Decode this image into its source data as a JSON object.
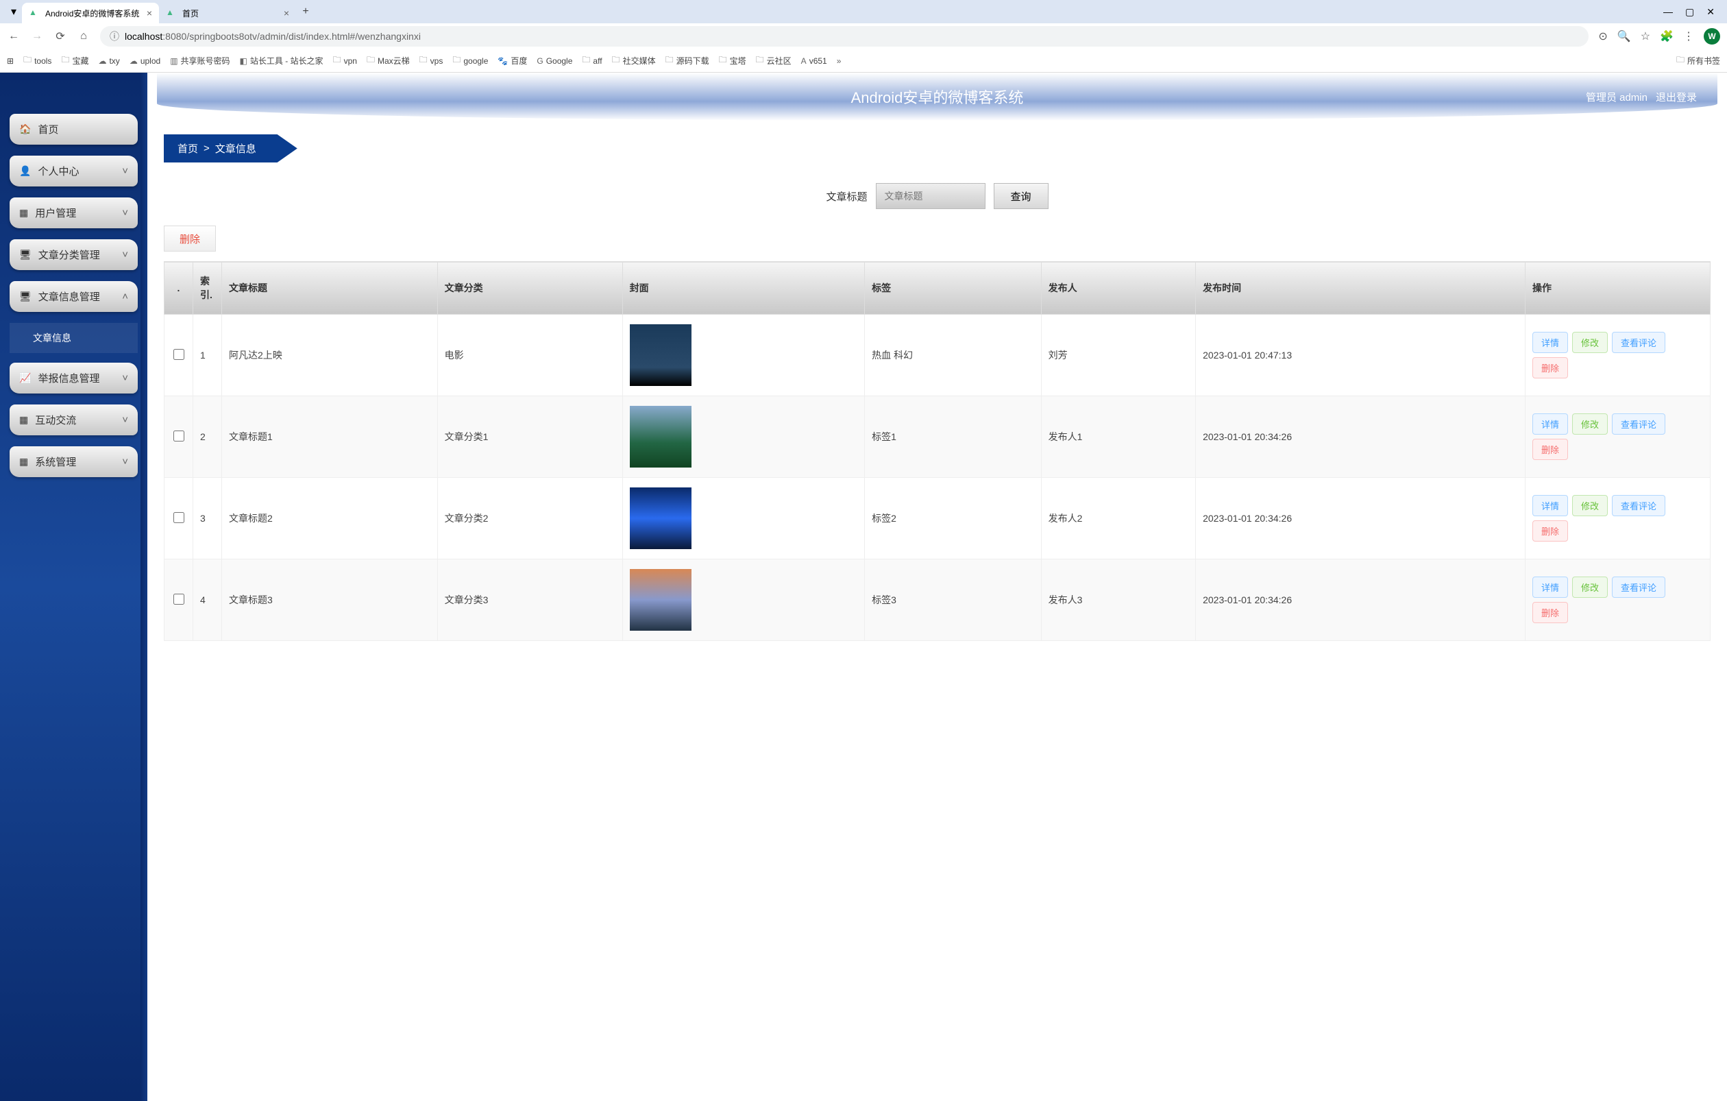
{
  "browser": {
    "tabs": [
      {
        "title": "Android安卓的微博客系统",
        "active": true
      },
      {
        "title": "首页",
        "active": false
      }
    ],
    "url_host": "localhost",
    "url_port": ":8080",
    "url_path": "/springboots8otv/admin/dist/index.html#/wenzhangxinxi",
    "avatar_letter": "W",
    "bookmarks": [
      {
        "label": "tools",
        "icon": "folder"
      },
      {
        "label": "宝藏",
        "icon": "folder"
      },
      {
        "label": "txy",
        "icon": "cloud"
      },
      {
        "label": "uplod",
        "icon": "cloud"
      },
      {
        "label": "共享账号密码",
        "icon": "sheet"
      },
      {
        "label": "站长工具 - 站长之家",
        "icon": "site"
      },
      {
        "label": "vpn",
        "icon": "folder"
      },
      {
        "label": "Max云梯",
        "icon": "folder"
      },
      {
        "label": "vps",
        "icon": "folder"
      },
      {
        "label": "google",
        "icon": "folder"
      },
      {
        "label": "百度",
        "icon": "baidu"
      },
      {
        "label": "Google",
        "icon": "g"
      },
      {
        "label": "aff",
        "icon": "folder"
      },
      {
        "label": "社交媒体",
        "icon": "folder"
      },
      {
        "label": "源码下载",
        "icon": "folder"
      },
      {
        "label": "宝塔",
        "icon": "folder"
      },
      {
        "label": "云社区",
        "icon": "folder"
      },
      {
        "label": "v651",
        "icon": "a"
      }
    ],
    "all_bookmarks": "所有书签"
  },
  "app": {
    "title": "Android安卓的微博客系统",
    "user_role": "管理员 admin",
    "logout": "退出登录"
  },
  "sidebar": {
    "items": [
      {
        "label": "首页",
        "icon": "🏠",
        "expandable": false
      },
      {
        "label": "个人中心",
        "icon": "👤",
        "expandable": true,
        "expanded": false
      },
      {
        "label": "用户管理",
        "icon": "▦",
        "expandable": true,
        "expanded": false
      },
      {
        "label": "文章分类管理",
        "icon": "🖥",
        "expandable": true,
        "expanded": false
      },
      {
        "label": "文章信息管理",
        "icon": "🖥",
        "expandable": true,
        "expanded": true
      },
      {
        "label": "举报信息管理",
        "icon": "📈",
        "expandable": true,
        "expanded": false
      },
      {
        "label": "互动交流",
        "icon": "▦",
        "expandable": true,
        "expanded": false
      },
      {
        "label": "系统管理",
        "icon": "▦",
        "expandable": true,
        "expanded": false
      }
    ],
    "submenu_active": "文章信息"
  },
  "breadcrumb": {
    "home": "首页",
    "sep": ">",
    "current": "文章信息"
  },
  "search": {
    "label": "文章标题",
    "placeholder": "文章标题",
    "button": "查询"
  },
  "bulk_delete": "删除",
  "table": {
    "headers": {
      "ck": ".",
      "idx": "索引.",
      "title": "文章标题",
      "cat": "文章分类",
      "cover": "封面",
      "tag": "标签",
      "author": "发布人",
      "time": "发布时间",
      "ops": "操作"
    },
    "ops_labels": {
      "detail": "详情",
      "edit": "修改",
      "review": "查看评论",
      "del": "删除"
    },
    "rows": [
      {
        "idx": "1",
        "title": "阿凡达2上映",
        "cat": "电影",
        "cover": "c1",
        "tag": "热血 科幻",
        "author": "刘芳",
        "time": "2023-01-01 20:47:13"
      },
      {
        "idx": "2",
        "title": "文章标题1",
        "cat": "文章分类1",
        "cover": "c2",
        "tag": "标签1",
        "author": "发布人1",
        "time": "2023-01-01 20:34:26"
      },
      {
        "idx": "3",
        "title": "文章标题2",
        "cat": "文章分类2",
        "cover": "c3",
        "tag": "标签2",
        "author": "发布人2",
        "time": "2023-01-01 20:34:26"
      },
      {
        "idx": "4",
        "title": "文章标题3",
        "cat": "文章分类3",
        "cover": "c4",
        "tag": "标签3",
        "author": "发布人3",
        "time": "2023-01-01 20:34:26"
      }
    ]
  }
}
